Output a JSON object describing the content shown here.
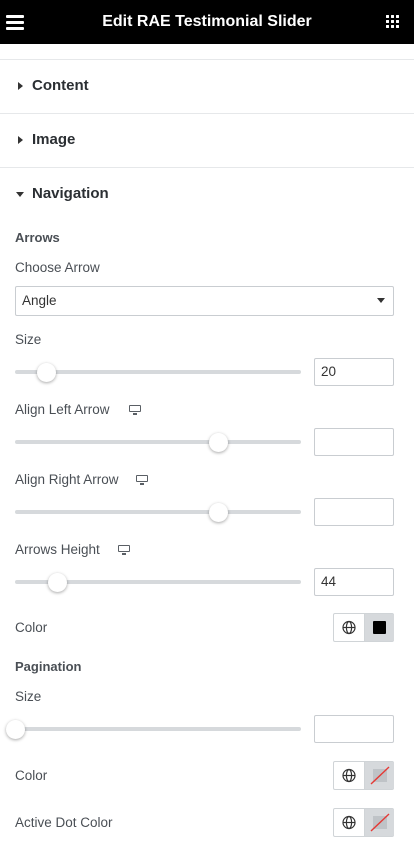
{
  "header": {
    "title": "Edit RAE Testimonial Slider",
    "menu_icon": "hamburger-menu-icon",
    "apps_icon": "grid-apps-icon"
  },
  "sections": [
    {
      "label": "Content",
      "state": "collapsed"
    },
    {
      "label": "Image",
      "state": "collapsed"
    },
    {
      "label": "Navigation",
      "state": "expanded"
    }
  ],
  "arrows": {
    "heading": "Arrows",
    "choose_arrow": {
      "label": "Choose Arrow",
      "value": "Angle"
    },
    "size": {
      "label": "Size",
      "value": "20",
      "slider_fraction": 0.11
    },
    "align_left": {
      "label": "Align Left Arrow",
      "value": "",
      "slider_fraction": 0.71,
      "device_icon": "desktop-monitor-icon"
    },
    "align_right": {
      "label": "Align Right Arrow",
      "value": "",
      "slider_fraction": 0.71,
      "device_icon": "desktop-monitor-icon"
    },
    "height": {
      "label": "Arrows Height",
      "value": "44",
      "slider_fraction": 0.15,
      "device_icon": "desktop-monitor-icon"
    },
    "color": {
      "label": "Color",
      "value": "#000000"
    }
  },
  "pagination": {
    "heading": "Pagination",
    "size": {
      "label": "Size",
      "value": "",
      "slider_fraction": 0.0
    },
    "color": {
      "label": "Color",
      "value": "none"
    },
    "active_dot_color": {
      "label": "Active Dot Color",
      "value": "none"
    }
  },
  "colors": {
    "header_bg": "#000000",
    "track": "#d6d9dc",
    "border": "#c9cdd1",
    "text": "#4a4f55",
    "empty_swatch_line": "#e53935"
  }
}
